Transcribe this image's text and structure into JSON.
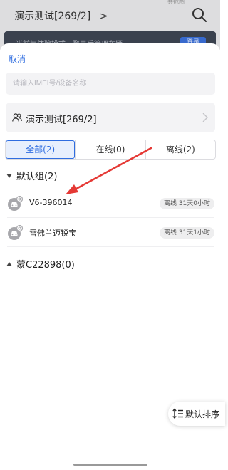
{
  "underlay": {
    "title": "演示测试[269/2]",
    "title_arrow": ">",
    "top_right_text": "共截图",
    "banner_text": "当前为体验模式，登录后管理车辆",
    "banner_button": "登录"
  },
  "sheet": {
    "cancel_label": "取消",
    "search_placeholder": "请输入IMEI号/设备名称",
    "group_selector": "演示测试[269/2]",
    "tabs": [
      {
        "label": "全部(2)",
        "active": true
      },
      {
        "label": "在线(0)",
        "active": false
      },
      {
        "label": "离线(2)",
        "active": false
      }
    ],
    "groups": [
      {
        "name": "默认组(2)",
        "expanded": true,
        "devices": [
          {
            "name": "V6-396014",
            "status": "离线 31天0小时"
          },
          {
            "name": "雪佛兰迈锐宝",
            "status": "离线 31天1小时"
          }
        ]
      },
      {
        "name": "蒙C22898(0)",
        "expanded": false,
        "devices": []
      }
    ],
    "sort_label": "默认排序"
  },
  "colors": {
    "accent": "#2f6de0",
    "annotation_arrow": "#e53935"
  }
}
